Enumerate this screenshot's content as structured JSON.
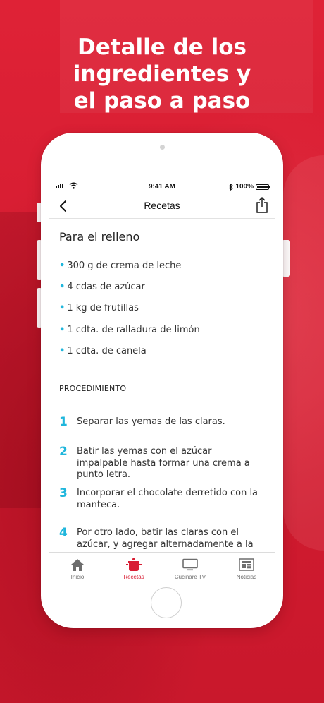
{
  "headline": [
    "Detalle de los",
    "ingredientes y",
    "el paso a paso"
  ],
  "status_bar": {
    "time": "9:41 AM",
    "battery": "100%"
  },
  "nav": {
    "title": "Recetas"
  },
  "recipe": {
    "section_title": "Para el relleno",
    "ingredients": [
      "300 g de crema de leche",
      "4 cdas de azúcar",
      "1 kg de frutillas",
      "1 cdta. de ralladura de limón",
      "1 cdta. de canela"
    ],
    "procedure_title": "PROCEDIMIENTO",
    "steps": [
      {
        "num": "1",
        "lines": [
          "Separar las yemas de las claras."
        ]
      },
      {
        "num": "2",
        "lines": [
          "Batir las yemas con el azúcar",
          "impalpable hasta formar una crema a",
          "punto letra."
        ]
      },
      {
        "num": "3",
        "lines": [
          "Incorporar el chocolate derretido con la",
          "manteca."
        ]
      },
      {
        "num": "4",
        "lines": [
          "Por otro lado, batir las claras con el",
          "azúcar, y agregar alternadamente a la"
        ]
      }
    ]
  },
  "tabs": [
    {
      "label": "Inicio",
      "icon": "home-icon",
      "active": false
    },
    {
      "label": "Recetas",
      "icon": "pot-icon",
      "active": true
    },
    {
      "label": "Cucinare TV",
      "icon": "tv-icon",
      "active": false
    },
    {
      "label": "Noticias",
      "icon": "newspaper-icon",
      "active": false
    }
  ],
  "colors": {
    "brand_red": "#d81e34",
    "accent_cyan": "#1fb6dc",
    "tab_inactive": "#6d6d6d"
  }
}
